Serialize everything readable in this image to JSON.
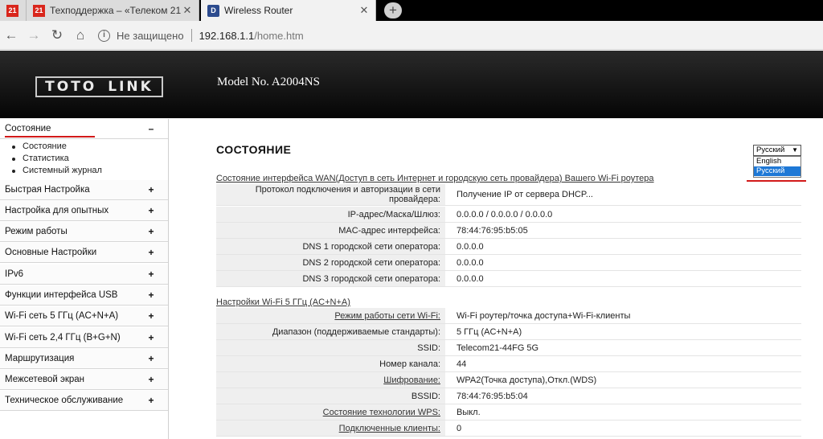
{
  "browser": {
    "tabs": [
      {
        "icon_text": "21",
        "title": ""
      },
      {
        "icon_text": "21",
        "title": "Техподдержка – «Телеком 21»"
      },
      {
        "icon_text": "D",
        "title": "Wireless Router"
      }
    ],
    "newtab": "+",
    "security_text": "Не защищено",
    "url_host": "192.168.1.1",
    "url_path": "/home.htm"
  },
  "header": {
    "logo_left": "TOTO",
    "logo_right": "LINK",
    "model": "Model No. A2004NS"
  },
  "sidebar": {
    "open_item": {
      "label": "Состояние",
      "sign": "–"
    },
    "subitems": [
      "Состояние",
      "Статистика",
      "Системный журнал"
    ],
    "items": [
      {
        "label": "Быстрая Настройка",
        "sign": "+"
      },
      {
        "label": "Настройка для опытных",
        "sign": "+"
      },
      {
        "label": "Режим работы",
        "sign": "+"
      },
      {
        "label": "Основные Настройки",
        "sign": "+"
      },
      {
        "label": "IPv6",
        "sign": "+"
      },
      {
        "label": "Функции интерфейса USB",
        "sign": "+"
      },
      {
        "label": "Wi-Fi сеть 5 ГГц (AC+N+A)",
        "sign": "+"
      },
      {
        "label": "Wi-Fi сеть 2,4 ГГц (B+G+N)",
        "sign": "+"
      },
      {
        "label": "Маршрутизация",
        "sign": "+"
      },
      {
        "label": "Межсетевой экран",
        "sign": "+"
      },
      {
        "label": "Техническое обслуживание",
        "sign": "+"
      }
    ]
  },
  "main": {
    "title": "СОСТОЯНИЕ",
    "language": {
      "selected": "Русский",
      "options": [
        "English",
        "Русский"
      ]
    },
    "wan_section": {
      "heading": "Состояние интерфейса WAN(Доступ в сеть Интернет и городскую сеть провайдера) Вашего Wi-Fi роутера",
      "rows": [
        {
          "label": "Протокол подключения и авторизации в сети провайдера:",
          "value": "Получение IP от сервера DHCP..."
        },
        {
          "label": "IP-адрес/Маска/Шлюз:",
          "value": "0.0.0.0 / 0.0.0.0 / 0.0.0.0"
        },
        {
          "label": "MAC-адрес интерфейса:",
          "value": "78:44:76:95:b5:05"
        },
        {
          "label": "DNS 1 городской сети оператора:",
          "value": "0.0.0.0"
        },
        {
          "label": "DNS 2 городской сети оператора:",
          "value": "0.0.0.0"
        },
        {
          "label": "DNS 3 городской сети оператора:",
          "value": "0.0.0.0"
        }
      ]
    },
    "wifi_section": {
      "heading": "Настройки Wi-Fi 5 ГГц (AC+N+A)",
      "rows": [
        {
          "label": "Режим работы сети Wi-Fi:",
          "value": "Wi-Fi роутер/точка доступа+Wi-Fi-клиенты"
        },
        {
          "label": "Диапазон (поддерживаемые стандарты):",
          "value": "5 ГГц (AC+N+A)"
        },
        {
          "label": "SSID:",
          "value": "Telecom21-44FG 5G"
        },
        {
          "label": "Номер канала:",
          "value": "44"
        },
        {
          "label": "Шифрование:",
          "value": "WPA2(Точка доступа),Откл.(WDS)"
        },
        {
          "label": "BSSID:",
          "value": "78:44:76:95:b5:04"
        },
        {
          "label": "Состояние технологии WPS:",
          "value": "Выкл."
        },
        {
          "label": "Подключенные клиенты:",
          "value": "0"
        }
      ]
    }
  },
  "colors": {
    "accent_red": "#d21a1a",
    "header_bg": "#111111",
    "selected_blue": "#1e78d6"
  }
}
